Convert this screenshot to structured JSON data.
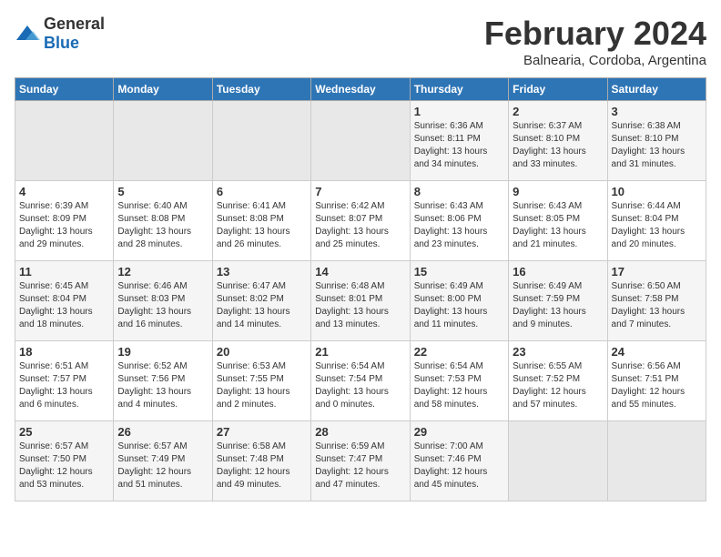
{
  "logo": {
    "general": "General",
    "blue": "Blue"
  },
  "title": "February 2024",
  "subtitle": "Balnearia, Cordoba, Argentina",
  "days_of_week": [
    "Sunday",
    "Monday",
    "Tuesday",
    "Wednesday",
    "Thursday",
    "Friday",
    "Saturday"
  ],
  "weeks": [
    [
      {
        "num": "",
        "info": ""
      },
      {
        "num": "",
        "info": ""
      },
      {
        "num": "",
        "info": ""
      },
      {
        "num": "",
        "info": ""
      },
      {
        "num": "1",
        "info": "Sunrise: 6:36 AM\nSunset: 8:11 PM\nDaylight: 13 hours\nand 34 minutes."
      },
      {
        "num": "2",
        "info": "Sunrise: 6:37 AM\nSunset: 8:10 PM\nDaylight: 13 hours\nand 33 minutes."
      },
      {
        "num": "3",
        "info": "Sunrise: 6:38 AM\nSunset: 8:10 PM\nDaylight: 13 hours\nand 31 minutes."
      }
    ],
    [
      {
        "num": "4",
        "info": "Sunrise: 6:39 AM\nSunset: 8:09 PM\nDaylight: 13 hours\nand 29 minutes."
      },
      {
        "num": "5",
        "info": "Sunrise: 6:40 AM\nSunset: 8:08 PM\nDaylight: 13 hours\nand 28 minutes."
      },
      {
        "num": "6",
        "info": "Sunrise: 6:41 AM\nSunset: 8:08 PM\nDaylight: 13 hours\nand 26 minutes."
      },
      {
        "num": "7",
        "info": "Sunrise: 6:42 AM\nSunset: 8:07 PM\nDaylight: 13 hours\nand 25 minutes."
      },
      {
        "num": "8",
        "info": "Sunrise: 6:43 AM\nSunset: 8:06 PM\nDaylight: 13 hours\nand 23 minutes."
      },
      {
        "num": "9",
        "info": "Sunrise: 6:43 AM\nSunset: 8:05 PM\nDaylight: 13 hours\nand 21 minutes."
      },
      {
        "num": "10",
        "info": "Sunrise: 6:44 AM\nSunset: 8:04 PM\nDaylight: 13 hours\nand 20 minutes."
      }
    ],
    [
      {
        "num": "11",
        "info": "Sunrise: 6:45 AM\nSunset: 8:04 PM\nDaylight: 13 hours\nand 18 minutes."
      },
      {
        "num": "12",
        "info": "Sunrise: 6:46 AM\nSunset: 8:03 PM\nDaylight: 13 hours\nand 16 minutes."
      },
      {
        "num": "13",
        "info": "Sunrise: 6:47 AM\nSunset: 8:02 PM\nDaylight: 13 hours\nand 14 minutes."
      },
      {
        "num": "14",
        "info": "Sunrise: 6:48 AM\nSunset: 8:01 PM\nDaylight: 13 hours\nand 13 minutes."
      },
      {
        "num": "15",
        "info": "Sunrise: 6:49 AM\nSunset: 8:00 PM\nDaylight: 13 hours\nand 11 minutes."
      },
      {
        "num": "16",
        "info": "Sunrise: 6:49 AM\nSunset: 7:59 PM\nDaylight: 13 hours\nand 9 minutes."
      },
      {
        "num": "17",
        "info": "Sunrise: 6:50 AM\nSunset: 7:58 PM\nDaylight: 13 hours\nand 7 minutes."
      }
    ],
    [
      {
        "num": "18",
        "info": "Sunrise: 6:51 AM\nSunset: 7:57 PM\nDaylight: 13 hours\nand 6 minutes."
      },
      {
        "num": "19",
        "info": "Sunrise: 6:52 AM\nSunset: 7:56 PM\nDaylight: 13 hours\nand 4 minutes."
      },
      {
        "num": "20",
        "info": "Sunrise: 6:53 AM\nSunset: 7:55 PM\nDaylight: 13 hours\nand 2 minutes."
      },
      {
        "num": "21",
        "info": "Sunrise: 6:54 AM\nSunset: 7:54 PM\nDaylight: 13 hours\nand 0 minutes."
      },
      {
        "num": "22",
        "info": "Sunrise: 6:54 AM\nSunset: 7:53 PM\nDaylight: 12 hours\nand 58 minutes."
      },
      {
        "num": "23",
        "info": "Sunrise: 6:55 AM\nSunset: 7:52 PM\nDaylight: 12 hours\nand 57 minutes."
      },
      {
        "num": "24",
        "info": "Sunrise: 6:56 AM\nSunset: 7:51 PM\nDaylight: 12 hours\nand 55 minutes."
      }
    ],
    [
      {
        "num": "25",
        "info": "Sunrise: 6:57 AM\nSunset: 7:50 PM\nDaylight: 12 hours\nand 53 minutes."
      },
      {
        "num": "26",
        "info": "Sunrise: 6:57 AM\nSunset: 7:49 PM\nDaylight: 12 hours\nand 51 minutes."
      },
      {
        "num": "27",
        "info": "Sunrise: 6:58 AM\nSunset: 7:48 PM\nDaylight: 12 hours\nand 49 minutes."
      },
      {
        "num": "28",
        "info": "Sunrise: 6:59 AM\nSunset: 7:47 PM\nDaylight: 12 hours\nand 47 minutes."
      },
      {
        "num": "29",
        "info": "Sunrise: 7:00 AM\nSunset: 7:46 PM\nDaylight: 12 hours\nand 45 minutes."
      },
      {
        "num": "",
        "info": ""
      },
      {
        "num": "",
        "info": ""
      }
    ]
  ]
}
